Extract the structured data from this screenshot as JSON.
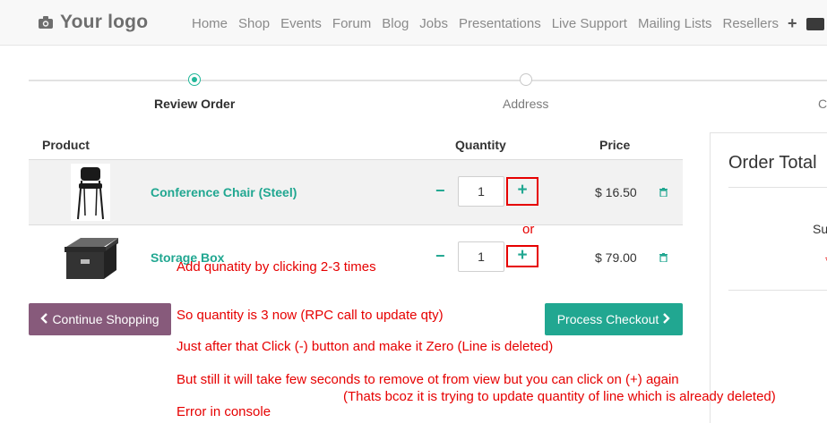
{
  "header": {
    "logo_text": "Your logo",
    "nav": [
      "Home",
      "Shop",
      "Events",
      "Forum",
      "Blog",
      "Jobs",
      "Presentations",
      "Live Support",
      "Mailing Lists",
      "Resellers"
    ],
    "plus": "+"
  },
  "wizard": {
    "steps": [
      "Review Order",
      "Address",
      "C"
    ]
  },
  "table": {
    "headers": {
      "product": "Product",
      "quantity": "Quantity",
      "price": "Price"
    },
    "rows": [
      {
        "name": "Conference Chair (Steel)",
        "qty": "1",
        "price": "$ 16.50",
        "minus": "−",
        "plus": "+"
      },
      {
        "name": "Storage Box",
        "qty": "1",
        "price": "$ 79.00",
        "minus": "−",
        "plus": "+"
      }
    ]
  },
  "buttons": {
    "continue": "Continue Shopping",
    "checkout": "Process Checkout",
    "continue_icon": "chevron-left-icon",
    "checkout_icon": "chevron-right-icon"
  },
  "order_total": {
    "title": "Order Total",
    "subtotal_label_partial": "Su",
    "red_mark": "*"
  },
  "annotations": {
    "or": "or",
    "line1": "Add qunatity by clicking 2-3 times",
    "line2": "So quantity is 3 now (RPC call to update qty)",
    "line3": "Just after that Click (-) button and make it Zero (Line is deleted)",
    "line4": "But still it will take few seconds to remove ot from view but you can click  on (+) again",
    "line5": "(Thats bcoz it is trying to update quantity of line which is already deleted)",
    "line6": "Error in console"
  },
  "colors": {
    "accent": "#21a791",
    "continue_button": "#875a7b",
    "annotation": "#e60000"
  }
}
